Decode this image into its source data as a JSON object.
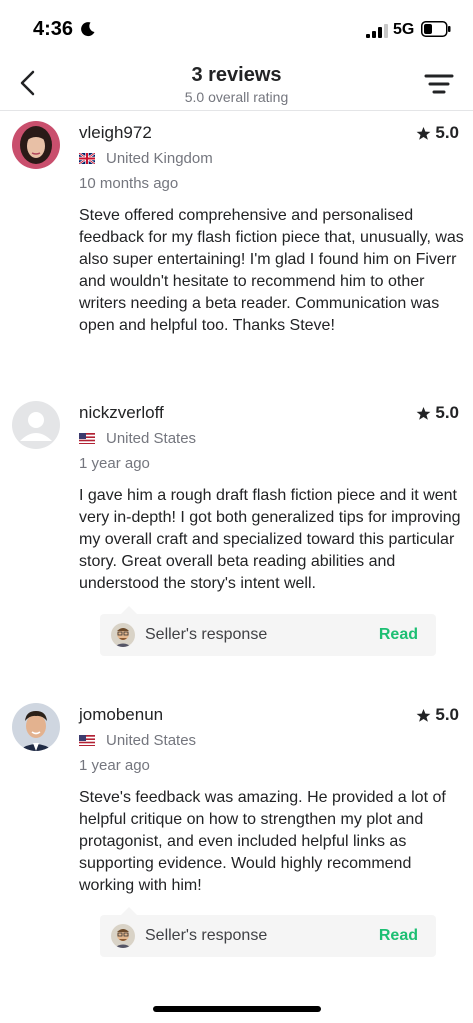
{
  "status": {
    "time": "4:36",
    "network": "5G",
    "icons": [
      "moon-icon",
      "signal-bars-icon",
      "battery-icon"
    ]
  },
  "header": {
    "title": "3 reviews",
    "subtitle": "5.0 overall rating",
    "icons": [
      "chevron-left-icon",
      "filter-icon"
    ]
  },
  "reviews": [
    {
      "username": "vleigh972",
      "rating": "5.0",
      "country": "United Kingdom",
      "flag": "uk-flag-icon",
      "time": "10 months ago",
      "text": "Steve offered comprehensive and personalised feedback for my flash fiction piece that, unusually, was also super entertaining! I'm glad I found him on Fiverr and wouldn't hesitate to recommend him to other writers needing a beta reader. Communication was open and helpful too. Thanks Steve!"
    },
    {
      "username": "nickzverloff",
      "rating": "5.0",
      "country": "United States",
      "flag": "us-flag-icon",
      "time": "1 year ago",
      "text": "I gave him a rough draft flash fiction piece and it went very in-depth! I got both generalized tips for improving my overall craft and specialized toward this particular story. Great overall beta reading abilities and understood the story's intent well.",
      "seller_response": {
        "label": "Seller's response",
        "action": "Read"
      }
    },
    {
      "username": "jomobenun",
      "rating": "5.0",
      "country": "United States",
      "flag": "us-flag-icon",
      "time": "1 year ago",
      "text": "Steve's feedback was amazing. He provided a lot of helpful critique on how to strengthen my plot and protagonist, and even included helpful links as supporting evidence. Would highly recommend working with him!",
      "seller_response": {
        "label": "Seller's response",
        "action": "Read"
      }
    }
  ],
  "colors": {
    "accent_green": "#1dbf73",
    "text_primary": "#222325",
    "text_secondary": "#74767e",
    "response_bg": "#f5f5f5"
  }
}
